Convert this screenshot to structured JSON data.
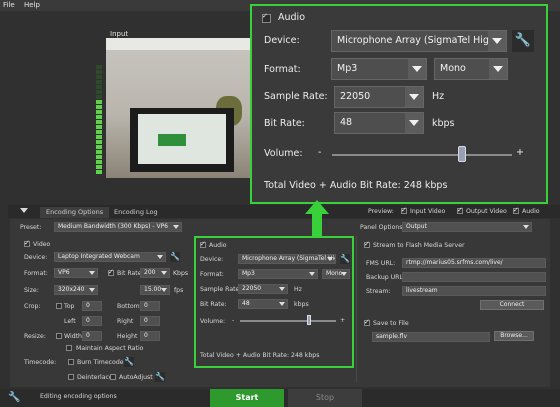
{
  "menu": {
    "file": "File",
    "help": "Help"
  },
  "preview": {
    "label": "Input"
  },
  "tabs": {
    "encoding_options": "Encoding Options",
    "encoding_log": "Encoding Log"
  },
  "preview_bar": {
    "label": "Preview:",
    "input_video": "Input Video",
    "output_video": "Output Video",
    "audio": "Audio"
  },
  "preset": {
    "label": "Preset:",
    "value": "Medium Bandwidth (300 Kbps) - VP6"
  },
  "video": {
    "label": "Video",
    "device_label": "Device:",
    "device_value": "Laptop Integrated Webcam",
    "format_label": "Format:",
    "format_value": "VP6",
    "bitrate_label": "Bit Rate",
    "bitrate_value": "200",
    "bitrate_unit": "Kbps",
    "size_label": "Size:",
    "size_value": "320x240",
    "fps_value": "15.00",
    "fps_unit": "fps",
    "crop_label": "Crop:",
    "top": "Top",
    "bottom": "Bottom",
    "left": "Left",
    "right": "Right",
    "crop_top": "0",
    "crop_bottom": "0",
    "crop_left": "0",
    "crop_right": "0",
    "resize_label": "Resize:",
    "width": "Width",
    "height": "Height",
    "resize_width": "0",
    "resize_height": "0",
    "maintain_aspect": "Maintain Aspect Ratio",
    "timecode_label": "Timecode:",
    "burn_timecode": "Burn Timecode",
    "deinterlace": "Deinterlace",
    "autoadjust": "AutoAdjust"
  },
  "audio_small": {
    "label": "Audio",
    "device_label": "Device:",
    "device_value": "Microphone Array (SigmaTel Hig",
    "format_label": "Format:",
    "format_value": "Mp3",
    "channel_value": "Mono",
    "sample_rate_label": "Sample Rate:",
    "sample_rate_value": "22050",
    "sample_rate_unit": "Hz",
    "bitrate_label": "Bit Rate:",
    "bitrate_value": "48",
    "bitrate_unit": "kbps",
    "volume_label": "Volume:",
    "volume_minus": "-",
    "volume_plus": "+",
    "total": "Total Video + Audio Bit Rate:  248 kbps"
  },
  "audio_big": {
    "label": "Audio",
    "device_label": "Device:",
    "device_value": "Microphone Array (SigmaTel Hig",
    "format_label": "Format:",
    "format_value": "Mp3",
    "channel_value": "Mono",
    "sample_rate_label": "Sample Rate:",
    "sample_rate_value": "22050",
    "sample_rate_unit": "Hz",
    "bitrate_label": "Bit Rate:",
    "bitrate_value": "48",
    "bitrate_unit": "kbps",
    "volume_label": "Volume:",
    "volume_minus": "-",
    "volume_plus": "+",
    "volume_level": 0.72,
    "total": "Total Video + Audio Bit Rate:  248 kbps"
  },
  "panel_options": {
    "label": "Panel Options:",
    "value": "Output"
  },
  "output": {
    "stream_label": "Stream to Flash Media Server",
    "fms_url_label": "FMS URL:",
    "fms_url_value": "rtmp://marius05.srfms.com/live/",
    "backup_url_label": "Backup URL:",
    "backup_url_value": "",
    "stream_label2": "Stream:",
    "stream_value": "livestream",
    "connect": "Connect",
    "save_label": "Save to File",
    "file_value": "sample.flv",
    "browse": "Browse..."
  },
  "status": {
    "text": "Editing encoding options"
  },
  "buttons": {
    "start": "Start",
    "stop": "Stop"
  },
  "colors": {
    "highlight": "#39d13a",
    "start": "#2e9a2e"
  }
}
